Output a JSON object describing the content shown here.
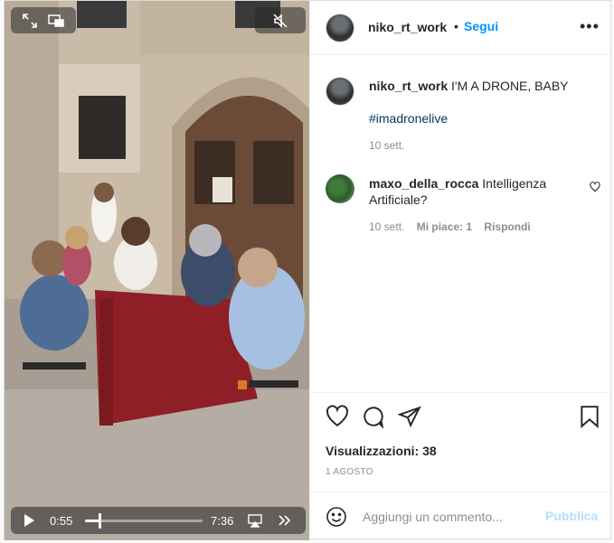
{
  "header": {
    "username": "niko_rt_work",
    "dot": "•",
    "follow_label": "Segui",
    "more_icon": "more-options-icon"
  },
  "caption": {
    "username": "niko_rt_work",
    "text": "I'M A DRONE, BABY",
    "hashtag": "#imadronelive",
    "date": "10 sett."
  },
  "comment": {
    "username": "maxo_della_rocca",
    "text": "Intelligenza Artificiale?",
    "date": "10 sett.",
    "likes": "Mi piace: 1",
    "reply_label": "Rispondi"
  },
  "stats": {
    "views": "Visualizzazioni: 38",
    "post_date": "1 AGOSTO"
  },
  "video": {
    "current_time": "0:55",
    "total_time": "7:36",
    "progress": 0.12
  },
  "comment_box": {
    "placeholder": "Aggiungi un commento...",
    "publish_label": "Pubblica"
  },
  "colors": {
    "link_blue": "#0095f6",
    "hashtag": "#00376b",
    "muted_text": "#8e8e8e",
    "publish_disabled": "#b2dffc"
  }
}
